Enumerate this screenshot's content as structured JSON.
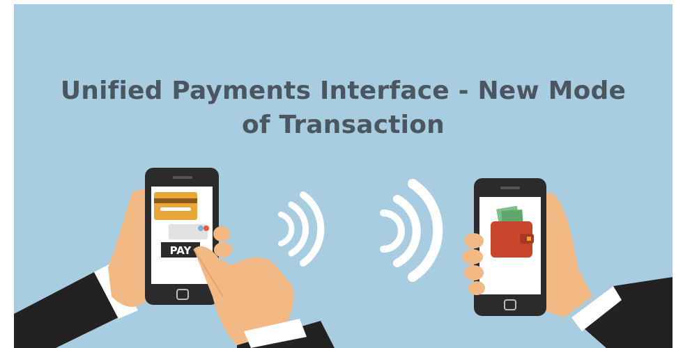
{
  "title": {
    "line1": "Unified Payments Interface - New Mode",
    "line2": "of Transaction"
  },
  "left_phone": {
    "pay_button_label": "PAY"
  },
  "icons": [
    "credit-card-icon",
    "wireless-signal-icon",
    "wallet-icon",
    "cash-icon"
  ],
  "colors": {
    "background": "#a9cde0",
    "title": "#4a5660",
    "phone": "#2b2b2b",
    "skin": "#f2b985",
    "sleeve": "#222222",
    "wallet": "#c8452c",
    "card": "#e8a838",
    "signal": "#ffffff"
  }
}
